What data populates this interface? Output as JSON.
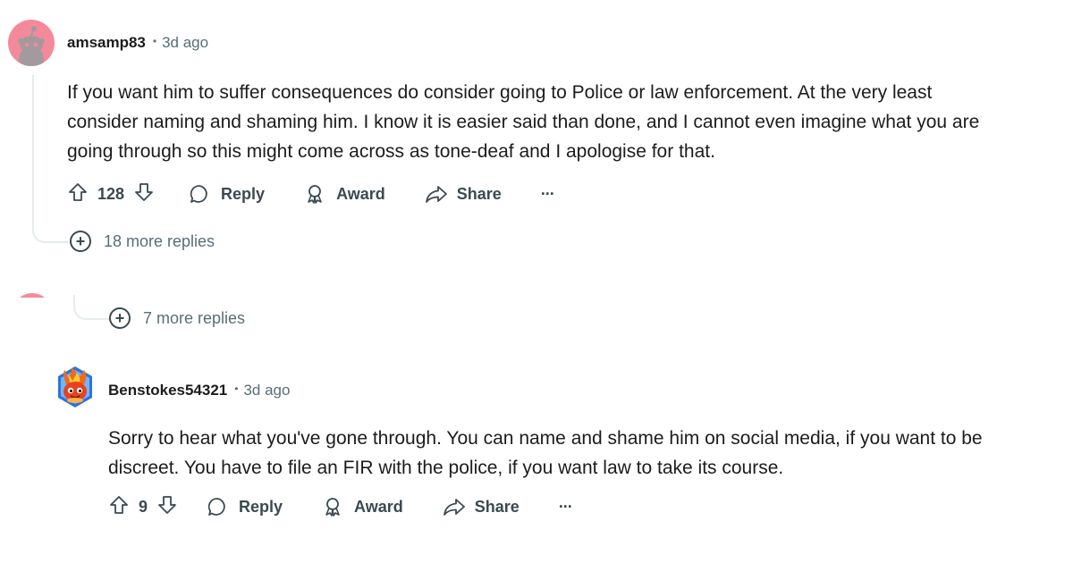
{
  "comments": [
    {
      "username": "amsamp83",
      "separator": "•",
      "timestamp": "3d ago",
      "body_lines": [
        "If you want him to suffer consequences do consider going to Police or law enforcement. At the very least",
        "consider naming and shaming him. I know it is easier said than done, and I cannot even imagine what you are",
        "going through so this might come across as tone-deaf and I apologise for that."
      ],
      "votes": "128",
      "reply_label": "Reply",
      "award_label": "Award",
      "share_label": "Share",
      "more_label": "···",
      "more_replies": "18 more replies",
      "avatar_icon": "snoo-avatar-icon"
    },
    {
      "more_replies": "7 more replies"
    },
    {
      "username": "Benstokes54321",
      "separator": "•",
      "timestamp": "3d ago",
      "body_lines": [
        "Sorry to hear what you've gone through. You can name and shame him on social media, if you want to be",
        "discreet. You have to file an FIR with the police, if you want law to take its course."
      ],
      "votes": "9",
      "reply_label": "Reply",
      "award_label": "Award",
      "share_label": "Share",
      "more_label": "···",
      "avatar_icon": "fire-creature-avatar-icon"
    }
  ],
  "colors": {
    "text": "#1c1c1c",
    "meta": "#576f76",
    "action": "#3a4a50",
    "avatar_pink": "#f4899a",
    "thread_line": "#e5ebee"
  }
}
